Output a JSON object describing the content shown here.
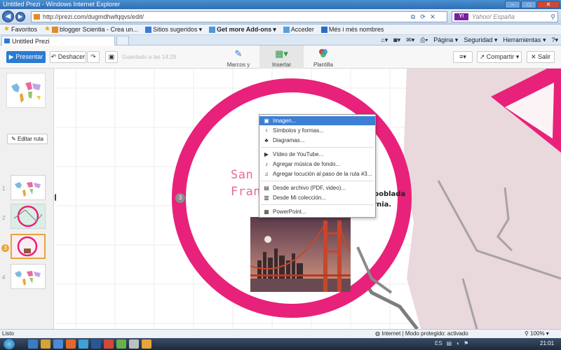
{
  "window": {
    "title": "Untitled Prezi - Windows Internet Explorer"
  },
  "addressbar": {
    "url": "http://prezi.com/dugmdhwfqqvs/edit/",
    "search_placeholder": "Yahoo! España"
  },
  "favorites": {
    "label": "Favoritos",
    "items": [
      "blogger Scientia - Crea un...",
      "Sitios sugeridos",
      "Get more Add-ons",
      "Acceder",
      "Més i més nombres"
    ]
  },
  "tab": {
    "title": "Untitled Prezi"
  },
  "commandbar": {
    "page": "Página",
    "security": "Seguridad",
    "tools": "Herramientas"
  },
  "toolbar": {
    "present": "Presentar",
    "undo": "Deshacer",
    "saved": "Guardado a las 14:29",
    "frames": "Marcos y flechas",
    "insert": "Insertar",
    "template": "Plantilla",
    "share": "Compartir",
    "exit": "Salir"
  },
  "sidebar": {
    "edit_route": "Editar ruta",
    "slides": [
      {
        "num": "1",
        "active": false
      },
      {
        "num": "2",
        "active": false
      },
      {
        "num": "3",
        "active": true
      },
      {
        "num": "4",
        "active": false
      }
    ]
  },
  "insert_menu": {
    "items": [
      {
        "label": "Imagen...",
        "icon": "image-icon",
        "selected": true
      },
      {
        "label": "Símbolos y formas...",
        "icon": "bulb-icon",
        "selected": false
      },
      {
        "label": "Diagramas...",
        "icon": "diagram-icon",
        "selected": false
      },
      {
        "label": "Vídeo de YouTube...",
        "icon": "youtube-icon",
        "selected": false
      },
      {
        "label": "Agregar música de fondo...",
        "icon": "music-icon",
        "selected": false
      },
      {
        "label": "Agregar locución al paso de la ruta #3...",
        "icon": "music-note-icon",
        "selected": false
      },
      {
        "label": "Desde archivo (PDF, video)...",
        "icon": "file-icon",
        "selected": false
      },
      {
        "label": "Desde Mi colección...",
        "icon": "collection-icon",
        "selected": false
      },
      {
        "label": "PowerPoint...",
        "icon": "powerpoint-icon",
        "selected": false
      }
    ]
  },
  "canvas": {
    "title": "San Francisco",
    "description": "-Cuarta ciudad más poblada del estado de California.",
    "step": "3"
  },
  "status": {
    "left": "Listo",
    "zone": "Internet | Modo protegido: activado",
    "zoom": "100%"
  },
  "taskbar": {
    "clock": "21:01",
    "lang": "ES"
  },
  "colors": {
    "accent": "#2a7bd3",
    "circle": "#e8217a",
    "menu_highlight": "#3d7fd4"
  }
}
